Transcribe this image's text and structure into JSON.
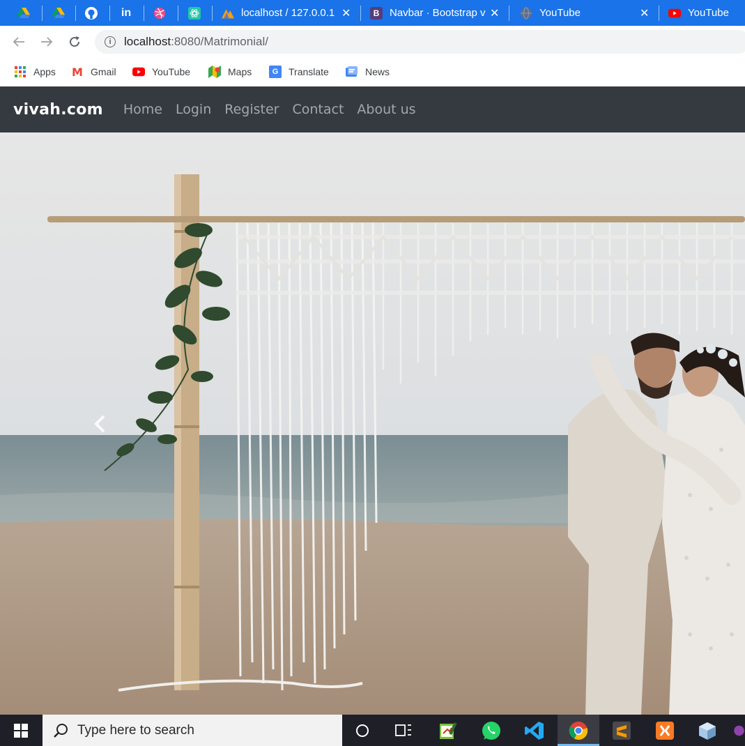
{
  "browser": {
    "tabs": [
      {
        "title": "",
        "icon": "google-drive-icon"
      },
      {
        "title": "",
        "icon": "google-drive-icon"
      },
      {
        "title": "",
        "icon": "github-icon"
      },
      {
        "title": "",
        "icon": "linkedin-icon"
      },
      {
        "title": "",
        "icon": "dribbble-icon"
      },
      {
        "title": "",
        "icon": "react-icon"
      },
      {
        "title": "localhost / 127.0.0.1",
        "icon": "phpmyadmin-icon"
      },
      {
        "title": "Navbar · Bootstrap v",
        "icon": "bootstrap-icon"
      },
      {
        "title": "YouTube",
        "icon": "globe-icon"
      },
      {
        "title": "YouTube",
        "icon": "youtube-icon"
      }
    ],
    "linkedin_glyph": "in",
    "bootstrap_glyph": "B",
    "address": {
      "host": "localhost",
      "rest": ":8080/Matrimonial/"
    },
    "bookmarks": [
      {
        "label": "Apps",
        "icon": "apps-grid-icon"
      },
      {
        "label": "Gmail",
        "icon": "gmail-icon"
      },
      {
        "label": "YouTube",
        "icon": "youtube-icon"
      },
      {
        "label": "Maps",
        "icon": "maps-icon"
      },
      {
        "label": "Translate",
        "icon": "translate-icon"
      },
      {
        "label": "News",
        "icon": "news-icon"
      }
    ],
    "gmail_glyph": "M",
    "translate_glyph": "G"
  },
  "site": {
    "brand": "vivah.com",
    "nav": [
      "Home",
      "Login",
      "Register",
      "Contact",
      "About us"
    ]
  },
  "taskbar": {
    "search_placeholder": "Type here to search",
    "apps": [
      "cortana-icon",
      "task-view-icon",
      "notepad-icon",
      "whatsapp-icon",
      "vscode-icon",
      "chrome-icon",
      "sublime-text-icon",
      "xampp-icon",
      "virtualbox-icon"
    ]
  },
  "colors": {
    "tab_strip": "#1a73e8",
    "site_navbar": "#343a40",
    "taskbar": "#1f1f27"
  }
}
